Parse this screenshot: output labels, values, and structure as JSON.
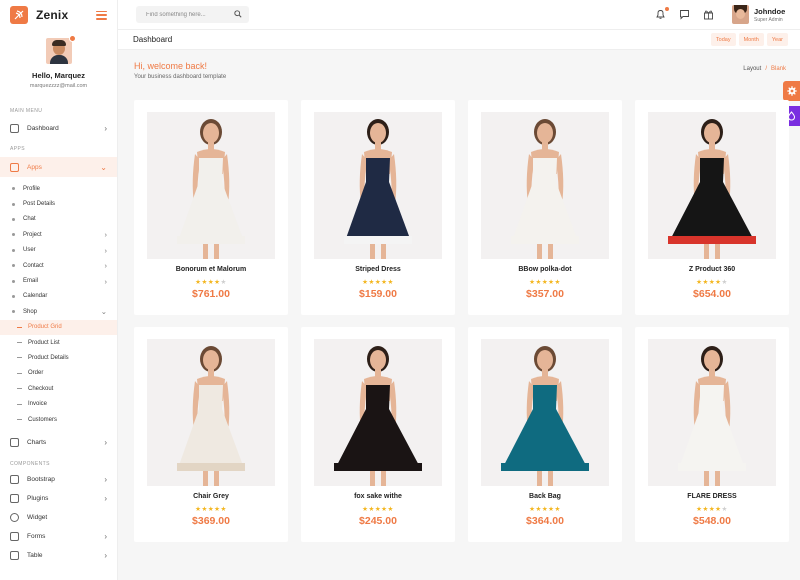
{
  "brand": {
    "name": "Zenix",
    "accent": "#ef7a45",
    "purple": "#7a2ee0"
  },
  "profile": {
    "greeting": "Hello, Marquez",
    "email": "marquezzzz@mail.com"
  },
  "sidebar": {
    "main_menu_label": "MAIN MENU",
    "dashboard": "Dashboard",
    "apps_label": "APPS",
    "apps": "Apps",
    "app_items": [
      "Profile",
      "Post Details",
      "Chat",
      "Project",
      "User",
      "Contact",
      "Email",
      "Calendar",
      "Shop"
    ],
    "shop_items": [
      "Product Grid",
      "Product List",
      "Product Details",
      "Order",
      "Checkout",
      "Invoice",
      "Customers"
    ],
    "charts": "Charts",
    "components_label": "COMPONENTS",
    "components": [
      "Bootstrap",
      "Plugins",
      "Widget",
      "Forms",
      "Table"
    ]
  },
  "header": {
    "search_placeholder": "Find something here...",
    "user_name": "Johndoe",
    "user_role": "Super Admin"
  },
  "subheader": {
    "title": "Dashboard",
    "ranges": [
      "Today",
      "Month",
      "Year"
    ]
  },
  "welcome": {
    "title": "Hi, welcome back!",
    "subtitle": "Your business dashboard template"
  },
  "breadcrumb": {
    "parent": "Layout",
    "separator": "/",
    "current": "Blank"
  },
  "products": [
    {
      "name": "Bonorum et Malorum",
      "price": "$761.00",
      "rating": 4,
      "dress_color": "#f2f0ec",
      "trim": "#f2f0ec"
    },
    {
      "name": "Striped Dress",
      "price": "$159.00",
      "rating": 5,
      "dress_color": "#1f2a44",
      "trim": "#f4f4f4"
    },
    {
      "name": "BBow polka-dot",
      "price": "$357.00",
      "rating": 5,
      "dress_color": "#f4f2ee",
      "trim": "#f4f2ee"
    },
    {
      "name": "Z Product 360",
      "price": "$654.00",
      "rating": 4,
      "dress_color": "#151515",
      "trim": "#d8342b"
    },
    {
      "name": "Chair Grey",
      "price": "$369.00",
      "rating": 5,
      "dress_color": "#efe9e1",
      "trim": "#e2d5c4"
    },
    {
      "name": "fox sake withe",
      "price": "$245.00",
      "rating": 5,
      "dress_color": "#1a1414",
      "trim": "#1a1414"
    },
    {
      "name": "Back Bag",
      "price": "$364.00",
      "rating": 5,
      "dress_color": "#0f6b80",
      "trim": "#0f6b80"
    },
    {
      "name": "FLARE DRESS",
      "price": "$548.00",
      "rating": 4,
      "dress_color": "#f5f4f1",
      "trim": "#f5f4f1"
    }
  ]
}
